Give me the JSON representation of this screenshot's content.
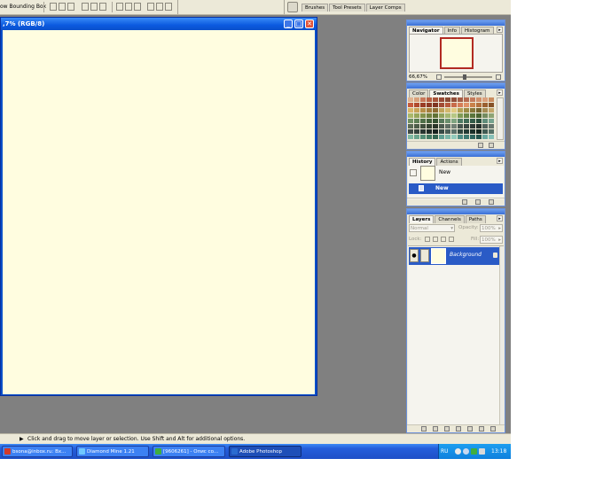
{
  "options_bar": {
    "bounding_box_label": "ow Bounding Box",
    "panel_well_tabs": [
      "Brushes",
      "Tool Presets",
      "Layer Comps"
    ]
  },
  "document": {
    "title": ",7% (RGB/8)",
    "minimize_glyph": "_",
    "maximize_glyph": "□",
    "close_glyph": "✕",
    "canvas_color": "#fffde0"
  },
  "navigator": {
    "tabs": [
      "Navigator",
      "Info",
      "Histogram"
    ],
    "zoom": "66,67%"
  },
  "swatches": {
    "tabs": [
      "Color",
      "Swatches",
      "Styles"
    ],
    "colors": [
      [
        "#e0b391",
        "#d9a07a",
        "#c8785a",
        "#b95f43",
        "#a8543a",
        "#984a36",
        "#8a4a35",
        "#934f3b",
        "#a55c45",
        "#b76a4f",
        "#c47b5b",
        "#d08e6a",
        "#dba07c",
        "#c98c5f"
      ],
      [
        "#c65a3c",
        "#b14a2e",
        "#9a3d26",
        "#8e3a25",
        "#7f3521",
        "#a24b34",
        "#b75a3d",
        "#c86b4a",
        "#d57e59",
        "#e09268",
        "#c9814a",
        "#b3703d",
        "#9b6031",
        "#865227"
      ],
      [
        "#d9b56a",
        "#c9a257",
        "#b78f48",
        "#a37d3d",
        "#8f6c33",
        "#c0a35a",
        "#d2b76d",
        "#e1ca83",
        "#b3a055",
        "#9d8b45",
        "#877639",
        "#72632f",
        "#a58b53",
        "#c3a66a"
      ],
      [
        "#aab86a",
        "#97a65a",
        "#84934c",
        "#728240",
        "#607135",
        "#8fa25c",
        "#a4b670",
        "#b6c784",
        "#7f9a55",
        "#6c8748",
        "#5a743c",
        "#4a6331",
        "#738b5f",
        "#8ea474"
      ],
      [
        "#6f8f63",
        "#5e7f55",
        "#4f6f48",
        "#41603c",
        "#355232",
        "#56785a",
        "#6a8e6c",
        "#7fa480",
        "#4f7a64",
        "#406a56",
        "#335b49",
        "#284d3d",
        "#5f8c7a",
        "#76a38f"
      ],
      [
        "#5c6b56",
        "#4e5d49",
        "#414f3d",
        "#354232",
        "#2a3528",
        "#4c5a4f",
        "#5f6d62",
        "#728075",
        "#46544e",
        "#3a4742",
        "#2f3b37",
        "#25302c",
        "#52625c",
        "#67776f"
      ],
      [
        "#3f4a45",
        "#33403b",
        "#283531",
        "#1f2b27",
        "#17221f",
        "#354a45",
        "#475d57",
        "#5a706a",
        "#2f4740",
        "#233b35",
        "#1a302a",
        "#13261f",
        "#3f5a52",
        "#547066"
      ],
      [
        "#7fb9a2",
        "#6aa48d",
        "#558f78",
        "#437b65",
        "#336753",
        "#5fa093",
        "#78b6a8",
        "#92cbbd",
        "#4f8f87",
        "#3e7b73",
        "#2f6760",
        "#22544e",
        "#6aa9a0",
        "#86c0b7"
      ]
    ]
  },
  "history": {
    "tabs": [
      "History",
      "Actions"
    ],
    "snapshot_label": "New",
    "state_label": "New"
  },
  "layers": {
    "tabs": [
      "Layers",
      "Channels",
      "Paths"
    ],
    "blend_mode": "Normal",
    "opacity_label": "Opacity:",
    "opacity_value": "100%",
    "lock_label": "Lock:",
    "fill_label": "Fill:",
    "fill_value": "100%",
    "layer_name": "Background"
  },
  "status": {
    "text": "Click and drag to move layer or selection.  Use Shift and Alt for additional options."
  },
  "taskbar": {
    "buttons": [
      {
        "label": "bsona@inbox.ru: Вх...",
        "icon_color": "#d23b2b"
      },
      {
        "label": "Diamond Mine 1.21",
        "icon_color": "#6fc8ff"
      },
      {
        "label": "[9606261] - Опис со...",
        "icon_color": "#3fae3f"
      },
      {
        "label": "Adobe Photoshop",
        "icon_color": "#2a6bd0"
      }
    ],
    "lang": "RU",
    "clock": "13:18"
  }
}
